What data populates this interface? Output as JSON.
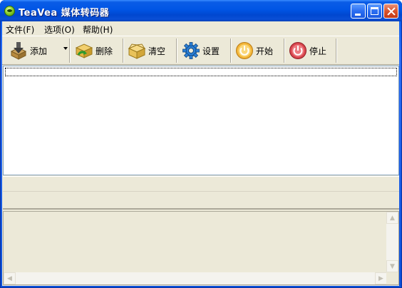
{
  "window": {
    "title": "TeaVea 媒体转码器"
  },
  "menu": {
    "items": [
      {
        "label": "文件(F)"
      },
      {
        "label": "选项(O)"
      },
      {
        "label": "帮助(H)"
      }
    ]
  },
  "toolbar": {
    "buttons": [
      {
        "label": "添加",
        "icon": "add-download-icon"
      },
      {
        "label": "删除",
        "icon": "box-delete-icon"
      },
      {
        "label": "清空",
        "icon": "box-clear-icon"
      },
      {
        "label": "设置",
        "icon": "gear-icon"
      },
      {
        "label": "开始",
        "icon": "power-start-icon"
      },
      {
        "label": "停止",
        "icon": "power-stop-icon"
      }
    ]
  },
  "colors": {
    "titlebar": "#0055e5",
    "client_bg": "#ece9d8",
    "close_button": "#d9532c"
  }
}
